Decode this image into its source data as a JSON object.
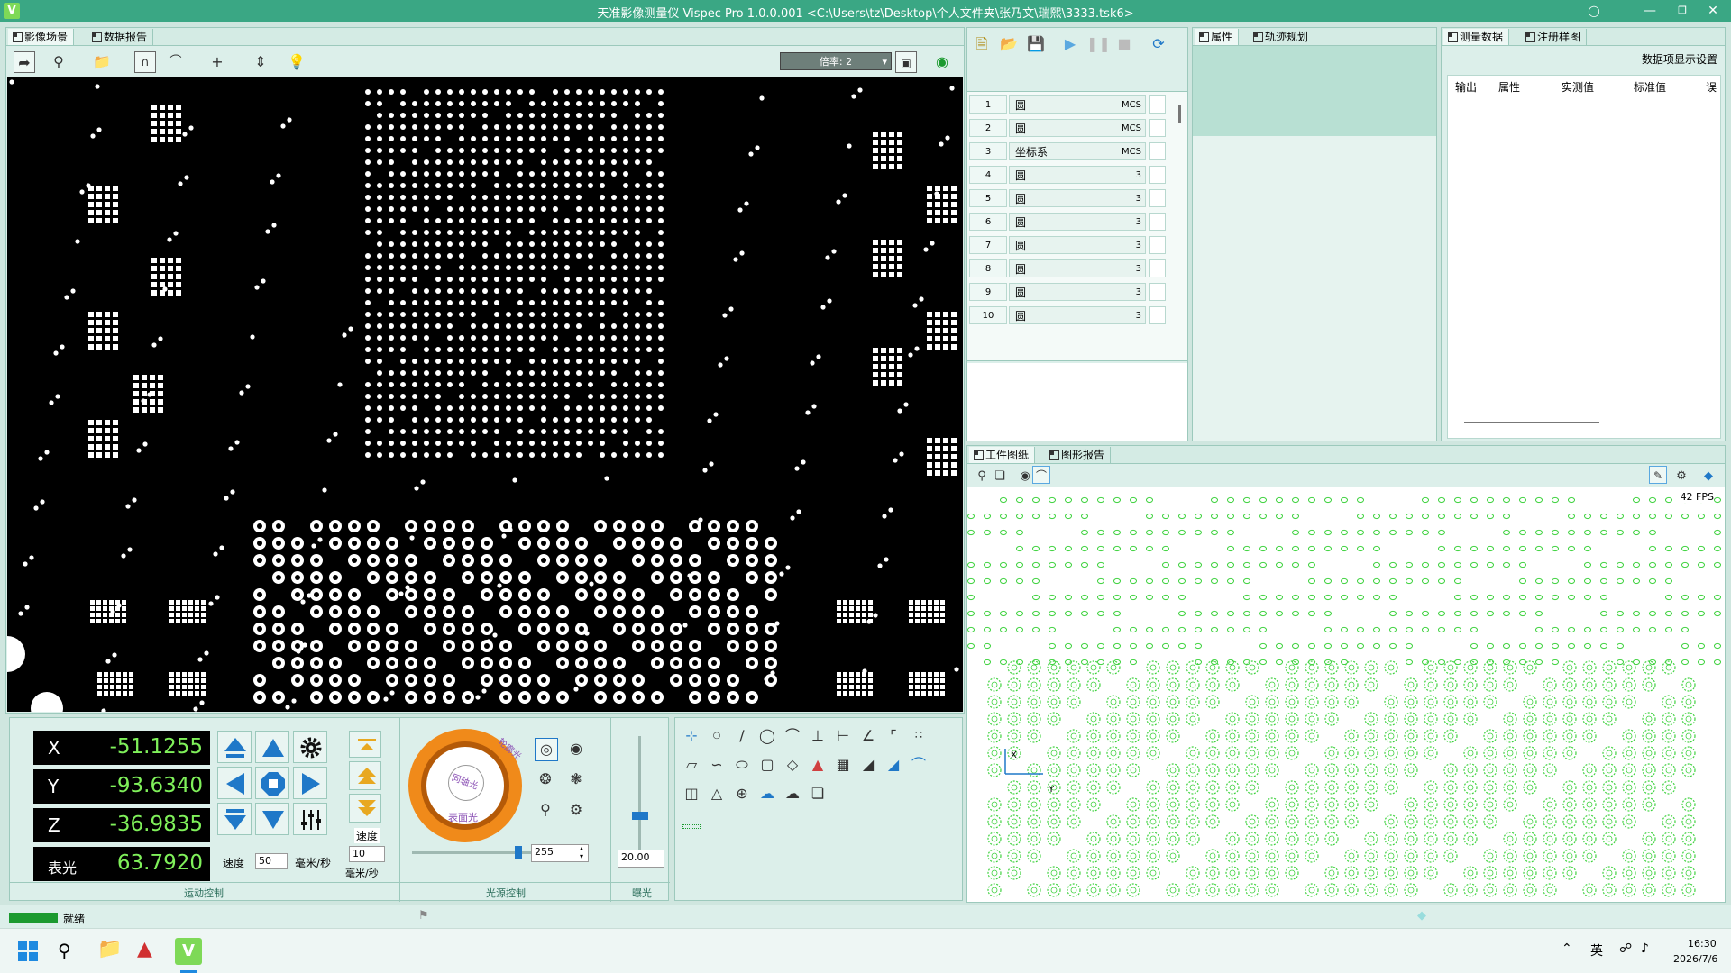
{
  "window": {
    "title": "天准影像测量仪 Vispec Pro 1.0.0.001  <C:\\Users\\tz\\Desktop\\个人文件夹\\张乃文\\瑞熙\\3333.tsk6>",
    "app_icon": "V"
  },
  "left_panel": {
    "tabs": [
      {
        "label": "影像场景"
      },
      {
        "label": "数据报告"
      }
    ],
    "magnification_label": "倍率: 2"
  },
  "motion": {
    "x_label": "X",
    "x_value": "-51.1255",
    "y_label": "Y",
    "y_value": "-93.6340",
    "z_label": "Z",
    "z_value": "-36.9835",
    "light_label": "表光",
    "light_value": "63.7920",
    "speed_label": "速度",
    "speed_value": "50",
    "speed_unit": "毫米/秒",
    "z_speed_label": "速度",
    "z_speed_value": "10",
    "z_speed_unit": "毫米/秒",
    "section_label": "运动控制"
  },
  "light": {
    "ring_outer_label": "轮廓光",
    "ring_inner_label": "同轴光",
    "surface_label": "表面光",
    "intensity_value": "255",
    "section_label": "光源控制"
  },
  "exposure": {
    "value": "20.00",
    "section_label": "曝光"
  },
  "element_list": {
    "rows": [
      {
        "num": "1",
        "name": "圆",
        "ref": "MCS"
      },
      {
        "num": "2",
        "name": "圆",
        "ref": "MCS"
      },
      {
        "num": "3",
        "name": "坐标系",
        "ref": "MCS"
      },
      {
        "num": "4",
        "name": "圆",
        "ref": "3"
      },
      {
        "num": "5",
        "name": "圆",
        "ref": "3"
      },
      {
        "num": "6",
        "name": "圆",
        "ref": "3"
      },
      {
        "num": "7",
        "name": "圆",
        "ref": "3"
      },
      {
        "num": "8",
        "name": "圆",
        "ref": "3"
      },
      {
        "num": "9",
        "name": "圆",
        "ref": "3"
      },
      {
        "num": "10",
        "name": "圆",
        "ref": "3"
      }
    ]
  },
  "props_panel": {
    "tabs": [
      {
        "label": "属性"
      },
      {
        "label": "轨迹规划"
      }
    ]
  },
  "measure_panel": {
    "tabs": [
      {
        "label": "测量数据"
      },
      {
        "label": "注册样图"
      }
    ],
    "settings_label": "数据项显示设置",
    "columns": [
      "输出",
      "属性",
      "实测值",
      "标准值",
      "误"
    ]
  },
  "drawing_panel": {
    "tabs": [
      {
        "label": "工件图纸"
      },
      {
        "label": "图形报告"
      }
    ],
    "fps": "42 FPS",
    "axis_x": "X",
    "axis_y": "Y"
  },
  "status": {
    "text": "就绪"
  },
  "taskbar": {
    "ime": "英",
    "time": "16:30",
    "date": "2026/7/6"
  },
  "colors": {
    "accent": "#3aa784",
    "readout_green": "#7ff05a",
    "drawing_green": "#3fd23f",
    "ring_orange": "#f08a1a"
  }
}
